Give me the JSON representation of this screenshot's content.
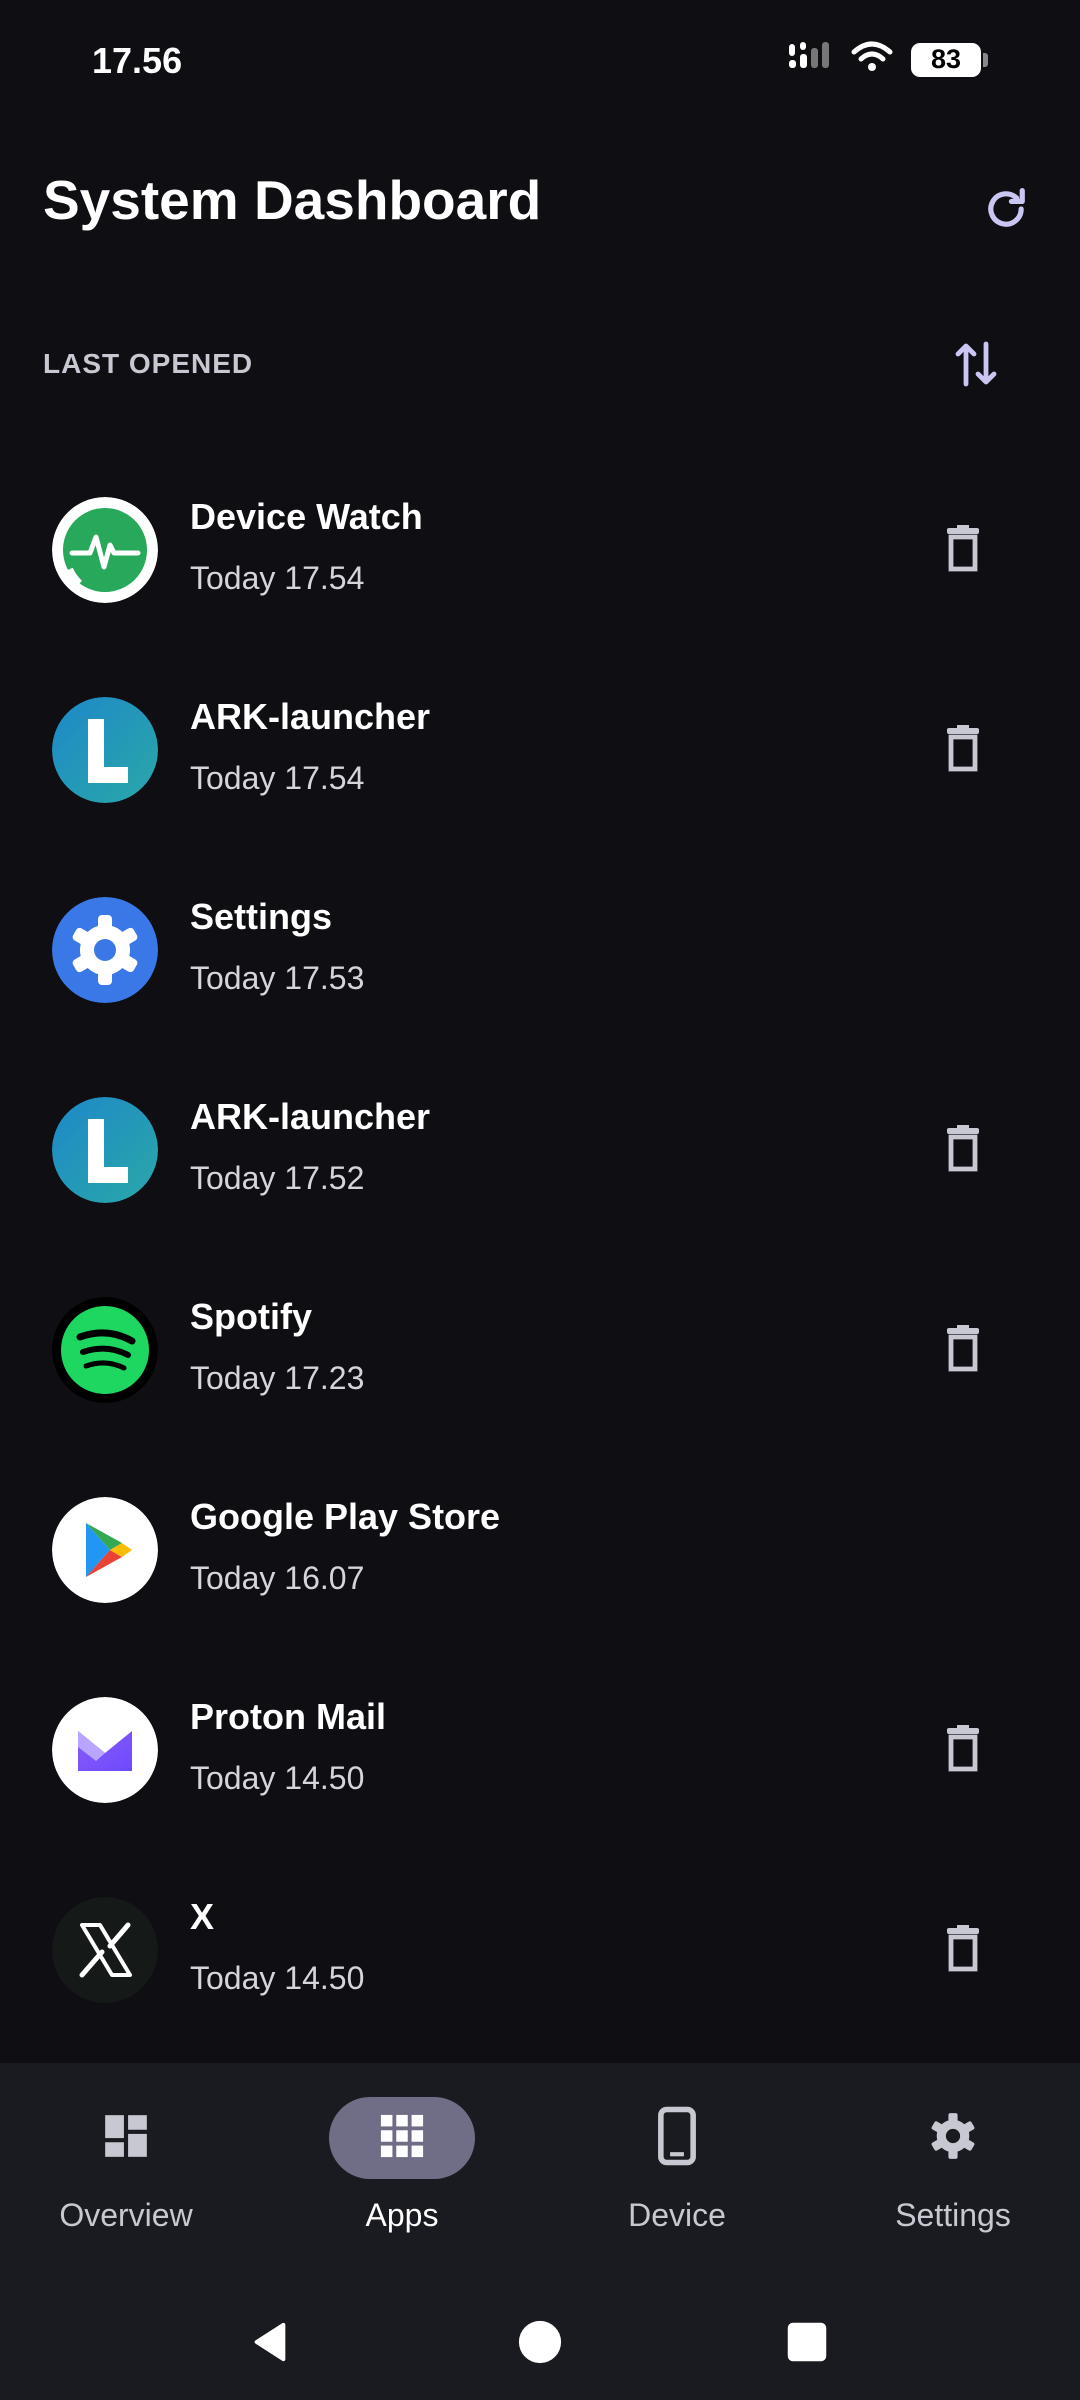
{
  "status": {
    "time": "17.56",
    "battery": "83",
    "signal_icon": "signal-icon",
    "wifi_icon": "wifi-icon"
  },
  "header": {
    "title": "System Dashboard",
    "refresh_icon": "refresh-icon"
  },
  "section": {
    "label": "LAST OPENED",
    "sort_icon": "sort-icon"
  },
  "apps": [
    {
      "name": "Device Watch",
      "time": "Today 17.54",
      "icon": "device-watch-icon",
      "deletable": true
    },
    {
      "name": "ARK-launcher",
      "time": "Today 17.54",
      "icon": "ark-launcher-icon",
      "deletable": true
    },
    {
      "name": "Settings",
      "time": "Today 17.53",
      "icon": "settings-app-icon",
      "deletable": false
    },
    {
      "name": "ARK-launcher",
      "time": "Today 17.52",
      "icon": "ark-launcher-icon",
      "deletable": true
    },
    {
      "name": "Spotify",
      "time": "Today 17.23",
      "icon": "spotify-icon",
      "deletable": true
    },
    {
      "name": "Google Play Store",
      "time": "Today 16.07",
      "icon": "play-store-icon",
      "deletable": false
    },
    {
      "name": "Proton Mail",
      "time": "Today 14.50",
      "icon": "proton-mail-icon",
      "deletable": true
    },
    {
      "name": "X",
      "time": "Today 14.50",
      "icon": "x-icon",
      "deletable": true
    }
  ],
  "nav": [
    {
      "label": "Overview",
      "icon": "dashboard-icon",
      "active": false
    },
    {
      "label": "Apps",
      "icon": "apps-grid-icon",
      "active": true
    },
    {
      "label": "Device",
      "icon": "phone-icon",
      "active": false
    },
    {
      "label": "Settings",
      "icon": "gear-icon",
      "active": false
    }
  ],
  "colors": {
    "background": "#0e0e13",
    "nav_background": "#1a1b20",
    "active_pill": "#6f6e86",
    "accent": "#c9c6f2"
  }
}
